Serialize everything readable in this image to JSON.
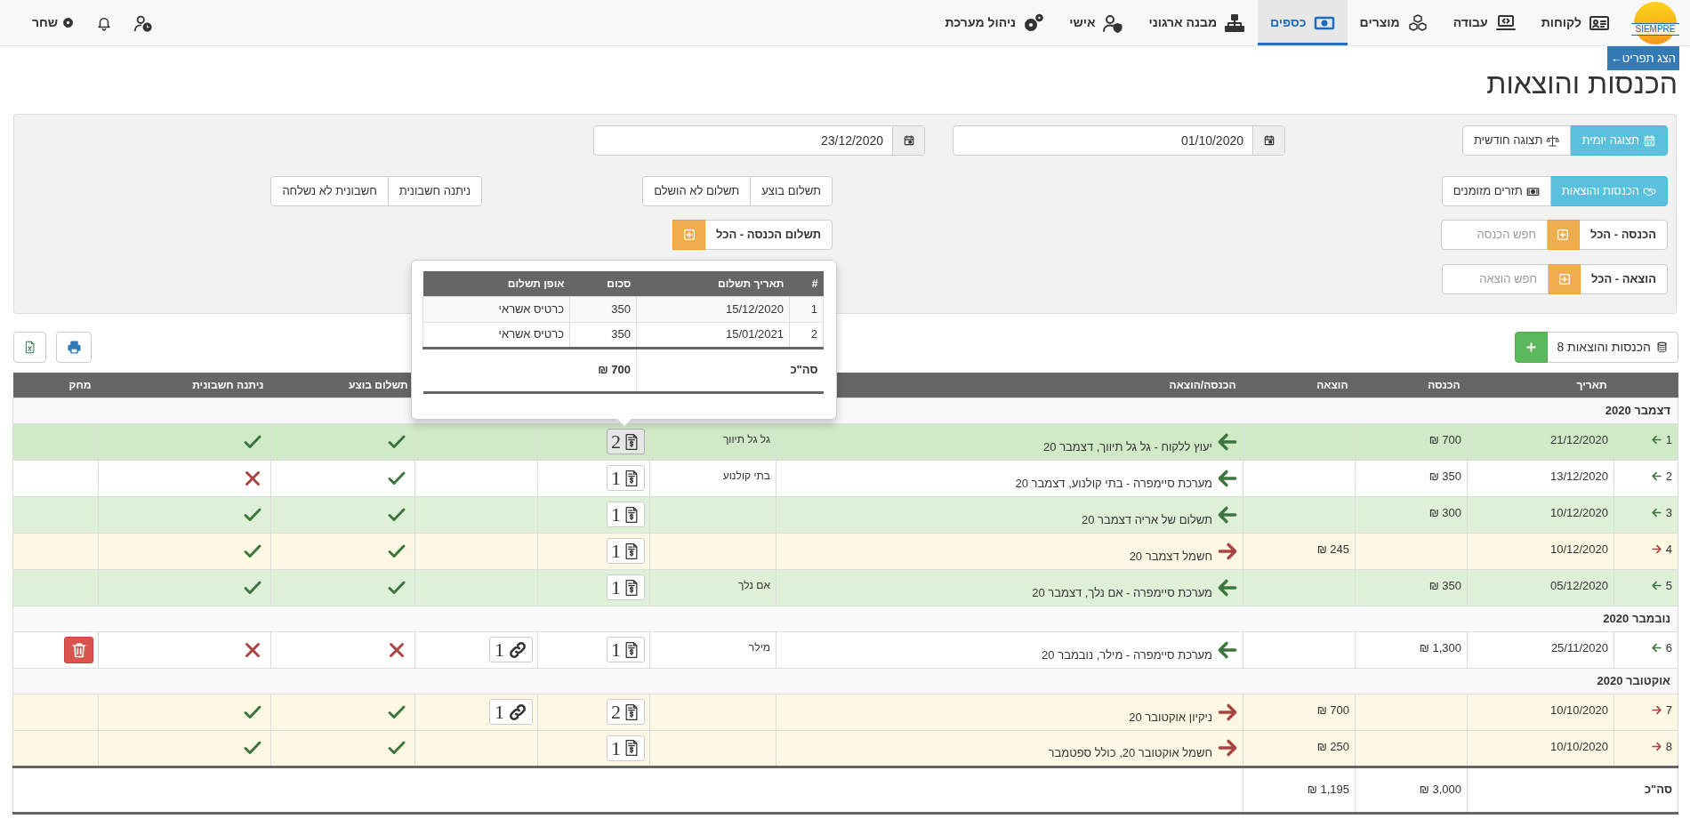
{
  "nav": {
    "logo": "SIEMPRE",
    "items": [
      {
        "label": "לקוחות",
        "selected": false
      },
      {
        "label": "עבודה",
        "selected": false
      },
      {
        "label": "מוצרים",
        "selected": false
      },
      {
        "label": "כספים",
        "selected": true
      },
      {
        "label": "מבנה ארגוני",
        "selected": false
      },
      {
        "label": "אישי",
        "selected": false
      },
      {
        "label": "ניהול מערכת",
        "selected": false
      }
    ],
    "user": "שחר"
  },
  "menu_toggle": "הצג תפריט←",
  "title": "הכנסות והוצאות",
  "filters": {
    "view_modes": [
      {
        "label": "תצוגה יומית",
        "selected": true
      },
      {
        "label": "תצוגה חודשית",
        "selected": false
      }
    ],
    "date_from": "01/10/2020",
    "date_to": "23/12/2020",
    "report_types": [
      {
        "label": "הכנסות והוצאות",
        "selected": true
      },
      {
        "label": "תזרים מזומנים",
        "selected": false
      }
    ],
    "payment_status": [
      {
        "label": "תשלום בוצע",
        "selected": false
      },
      {
        "label": "תשלום לא הושלם",
        "selected": false
      }
    ],
    "invoice_status": [
      {
        "label": "ניתנה חשבונית",
        "selected": false
      },
      {
        "label": "חשבונית לא נשלחה",
        "selected": false
      }
    ],
    "income_filter": {
      "label": "הכנסה - הכל",
      "placeholder": "חפש הכנסה"
    },
    "expense_filter": {
      "label": "הוצאה - הכל",
      "placeholder": "חפש הוצאה"
    },
    "income_payment_filter": {
      "label": "תשלום הכנסה - הכל"
    }
  },
  "toolbar": {
    "count_label": "הכנסות והוצאות 8"
  },
  "table": {
    "columns": [
      "תאריך",
      "הכנסה",
      "הוצאה",
      "הכנסה/הוצאה",
      "תשלום בוצע",
      "ניתנה חשבונית",
      "מחק"
    ],
    "groups": [
      {
        "month": "דצמבר 2020",
        "rows": [
          {
            "number": "1",
            "kind": "income",
            "date": "21/12/2020",
            "income": "700 ₪",
            "description": "יעוץ ללקוח - גל גל תיווך, דצמבר 20",
            "customer": "גל גל תיווך",
            "receipts": "2",
            "receipts_open": true,
            "paid": true,
            "invoiced": true,
            "deletable": false,
            "hovered": true
          },
          {
            "number": "2",
            "kind": "income",
            "date": "13/12/2020",
            "income": "350 ₪",
            "description": "מערכת סיימפרה - בתי קולנוע, דצמבר 20",
            "customer": "בתי קולנוע",
            "receipts": "1",
            "receipts_open": false,
            "paid": true,
            "invoiced": false,
            "deletable": false,
            "hovered": false
          },
          {
            "number": "3",
            "kind": "income",
            "date": "10/12/2020",
            "income": "300 ₪",
            "description": "תשלום של אריה דצמבר 20",
            "receipts": "1",
            "receipts_open": false,
            "paid": true,
            "invoiced": true,
            "deletable": false,
            "hovered": false
          },
          {
            "number": "4",
            "kind": "expense",
            "date": "10/12/2020",
            "expense": "245 ₪",
            "description": "חשמל דצמבר 20",
            "receipts": "1",
            "receipts_open": false,
            "paid": true,
            "invoiced": true,
            "deletable": false,
            "hovered": false
          },
          {
            "number": "5",
            "kind": "income",
            "date": "05/12/2020",
            "income": "350 ₪",
            "description": "מערכת סיימפרה - אם נלך, דצמבר 20",
            "customer": "אם נלך",
            "receipts": "1",
            "receipts_open": false,
            "paid": true,
            "invoiced": true,
            "deletable": false,
            "hovered": false
          }
        ]
      },
      {
        "month": "נובמבר 2020",
        "rows": [
          {
            "number": "6",
            "kind": "income",
            "date": "25/11/2020",
            "income": "1,300 ₪",
            "description": "מערכת סיימפרה - מילר, נובמבר 20",
            "customer": "מילר",
            "receipts": "1",
            "receipts_open": false,
            "links": "1",
            "paid": false,
            "invoiced": false,
            "deletable": true,
            "hovered": false
          }
        ]
      },
      {
        "month": "אוקטובר 2020",
        "rows": [
          {
            "number": "7",
            "kind": "expense",
            "date": "10/10/2020",
            "expense": "700 ₪",
            "description": "ניקיון אוקטובר 20",
            "receipts": "2",
            "receipts_open": false,
            "links": "1",
            "paid": true,
            "invoiced": true,
            "deletable": false,
            "hovered": false
          },
          {
            "number": "8",
            "kind": "expense",
            "date": "10/10/2020",
            "expense": "250 ₪",
            "description": "חשמל אוקטובר 20, כולל ספטמבר",
            "receipts": "1",
            "receipts_open": false,
            "paid": true,
            "invoiced": true,
            "deletable": false,
            "hovered": false
          }
        ]
      }
    ],
    "totals": {
      "label": "סה\"כ",
      "income": "3,000 ₪",
      "expense": "1,195 ₪"
    }
  },
  "popover": {
    "columns": [
      "#",
      "תאריך תשלום",
      "סכום",
      "אופן תשלום"
    ],
    "rows": [
      {
        "number": "1",
        "date": "15/12/2020",
        "amount": "350",
        "method": "כרטיס אשראי"
      },
      {
        "number": "2",
        "date": "15/01/2021",
        "amount": "350",
        "method": "כרטיס אשראי"
      }
    ],
    "total_label": "סה\"כ",
    "total": "700 ₪"
  }
}
